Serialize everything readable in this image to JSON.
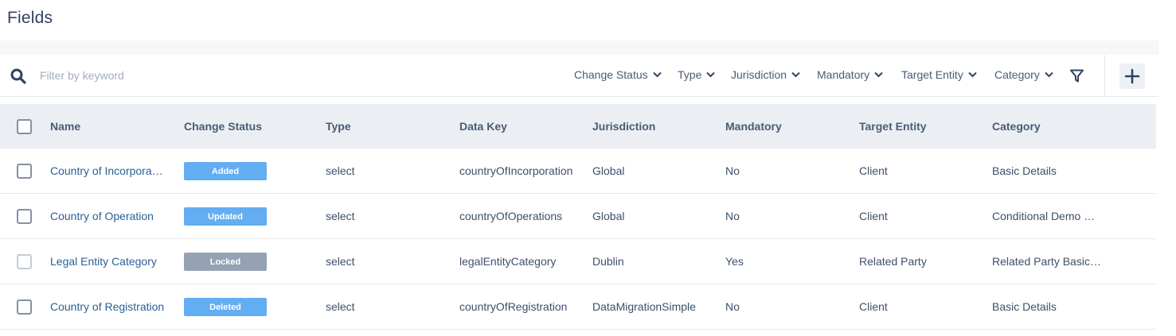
{
  "page": {
    "title": "Fields"
  },
  "search": {
    "placeholder": "Filter by keyword",
    "value": ""
  },
  "filters": [
    {
      "label": "Change Status"
    },
    {
      "label": "Type"
    },
    {
      "label": "Jurisdiction"
    },
    {
      "label": "Mandatory"
    },
    {
      "label": "Target Entity"
    },
    {
      "label": "Category"
    }
  ],
  "table": {
    "columns": [
      "Name",
      "Change Status",
      "Type",
      "Data Key",
      "Jurisdiction",
      "Mandatory",
      "Target Entity",
      "Category"
    ],
    "rows": [
      {
        "name": "Country of Incorporation",
        "status": "Added",
        "status_color": "#63adf2",
        "type": "select",
        "data_key": "countryOfIncorporation",
        "jurisdiction": "Global",
        "mandatory": "No",
        "target_entity": "Client",
        "category": "Basic Details",
        "checkbox_enabled": true
      },
      {
        "name": "Country of Operation",
        "status": "Updated",
        "status_color": "#63adf2",
        "type": "select",
        "data_key": "countryOfOperations",
        "jurisdiction": "Global",
        "mandatory": "No",
        "target_entity": "Client",
        "category": "Conditional Demo One",
        "checkbox_enabled": true
      },
      {
        "name": "Legal Entity Category",
        "status": "Locked",
        "status_color": "#94a2b3",
        "type": "select",
        "data_key": "legalEntityCategory",
        "jurisdiction": "Dublin",
        "mandatory": "Yes",
        "target_entity": "Related Party",
        "category": "Related Party Basic Details",
        "checkbox_enabled": false
      },
      {
        "name": "Country of Registration",
        "status": "Deleted",
        "status_color": "#63adf2",
        "type": "select",
        "data_key": "countryOfRegistration",
        "jurisdiction": "DataMigrationSimple",
        "mandatory": "No",
        "target_entity": "Client",
        "category": "Basic Details",
        "checkbox_enabled": true
      }
    ]
  },
  "icons": {
    "search": "search-icon",
    "chevron": "chevron-down-icon",
    "filter": "filter-funnel-icon",
    "add": "plus-icon"
  }
}
